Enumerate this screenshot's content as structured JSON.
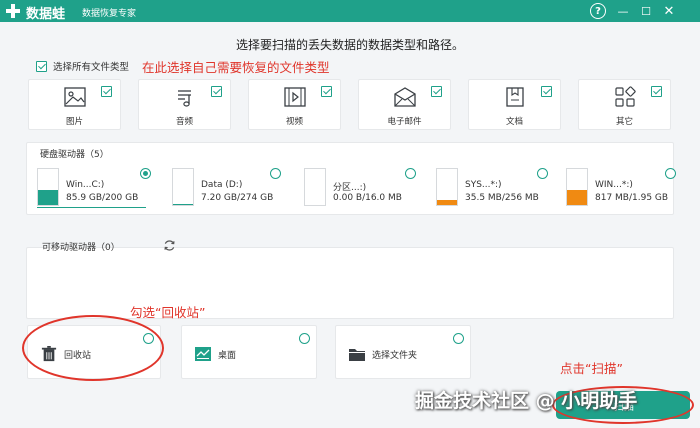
{
  "app": {
    "title": "数据蛙",
    "subtitle": "数据恢复专家",
    "controls": {
      "help": "?",
      "minimize": "—",
      "maximize": "☐",
      "close": "✕"
    }
  },
  "headline": "选择要扫描的丢失数据的数据类型和路径。",
  "select_all": {
    "label": "选择所有文件类型",
    "checked": true
  },
  "annotations": {
    "types_hint": "在此选择自己需要恢复的文件类型",
    "recycle_hint": "勾选“回收站”",
    "scan_hint": "点击“扫描”"
  },
  "file_types": [
    {
      "label": "图片",
      "icon": "image-icon",
      "checked": true
    },
    {
      "label": "音频",
      "icon": "music-icon",
      "checked": true
    },
    {
      "label": "视频",
      "icon": "video-icon",
      "checked": true
    },
    {
      "label": "电子邮件",
      "icon": "email-icon",
      "checked": true
    },
    {
      "label": "文档",
      "icon": "document-icon",
      "checked": true
    },
    {
      "label": "其它",
      "icon": "other-icon",
      "checked": true
    }
  ],
  "hard_drives": {
    "title": "硬盘驱动器（5）",
    "drives": [
      {
        "name": "Win...C:)",
        "size": "85.9 GB/200 GB",
        "used": 0.43,
        "color": "#1fa18a",
        "selected": true
      },
      {
        "name": "Data (D:)",
        "size": "7.20 GB/274 GB",
        "used": 0.03,
        "color": "#1fa18a",
        "selected": false
      },
      {
        "name": "分区...:)",
        "size": "0.00  B/16.0 MB",
        "used": 0.0,
        "color": "#1fa18a",
        "selected": false
      },
      {
        "name": "SYS...*:)",
        "size": "35.5 MB/256 MB",
        "used": 0.14,
        "color": "#f08a12",
        "selected": false
      },
      {
        "name": "WIN...*:)",
        "size": "817 MB/1.95 GB",
        "used": 0.42,
        "color": "#f08a12",
        "selected": false
      }
    ]
  },
  "removable": {
    "title": "可移动驱动器（0）"
  },
  "locations": [
    {
      "label": "回收站",
      "icon": "recycle-bin-icon"
    },
    {
      "label": "桌面",
      "icon": "desktop-icon"
    },
    {
      "label": "选择文件夹",
      "icon": "folder-icon"
    }
  ],
  "scan_button": {
    "label": "扫描"
  },
  "watermark": "掘金技术社区 @ 小明助手",
  "colors": {
    "brand": "#1fa18a",
    "annotation": "#e0352b",
    "warning_fill": "#f08a12"
  }
}
